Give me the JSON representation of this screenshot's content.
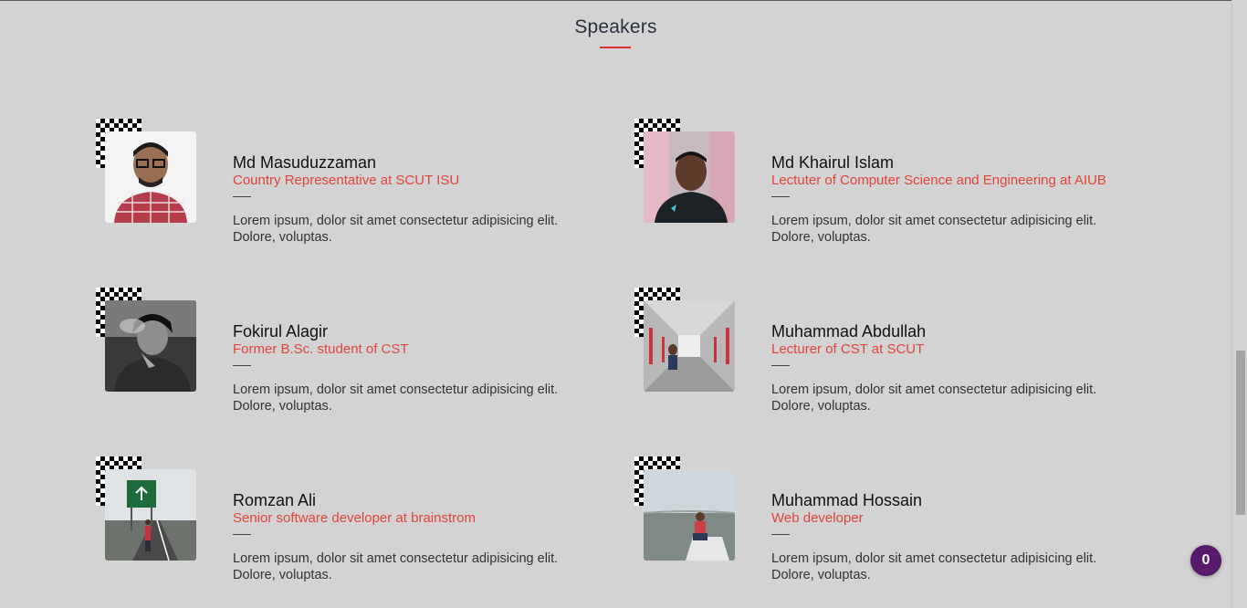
{
  "section": {
    "title": "Speakers"
  },
  "speakers": [
    {
      "name": "Md Masuduzzaman",
      "role": "Country Representative at SCUT ISU",
      "bio": "Lorem ipsum, dolor sit amet consectetur adipisicing elit. Dolore, voluptas."
    },
    {
      "name": "Md Khairul Islam",
      "role": "Lectuter of Computer Science and Engineering at AIUB",
      "bio": "Lorem ipsum, dolor sit amet consectetur adipisicing elit. Dolore, voluptas."
    },
    {
      "name": "Fokirul Alagir",
      "role": "Former B.Sc. student of CST",
      "bio": "Lorem ipsum, dolor sit amet consectetur adipisicing elit. Dolore, voluptas."
    },
    {
      "name": "Muhammad Abdullah",
      "role": "Lecturer of CST at SCUT",
      "bio": "Lorem ipsum, dolor sit amet consectetur adipisicing elit. Dolore, voluptas."
    },
    {
      "name": "Romzan Ali",
      "role": "Senior software developer at brainstrom",
      "bio": "Lorem ipsum, dolor sit amet consectetur adipisicing elit. Dolore, voluptas."
    },
    {
      "name": "Muhammad Hossain",
      "role": "Web developer",
      "bio": "Lorem ipsum, dolor sit amet consectetur adipisicing elit. Dolore, voluptas."
    }
  ],
  "cart": {
    "count": "0"
  },
  "colors": {
    "accent": "#e0453a",
    "underline": "#d9342b",
    "background": "#d3d3d3",
    "badge": "#5a1a6b"
  }
}
